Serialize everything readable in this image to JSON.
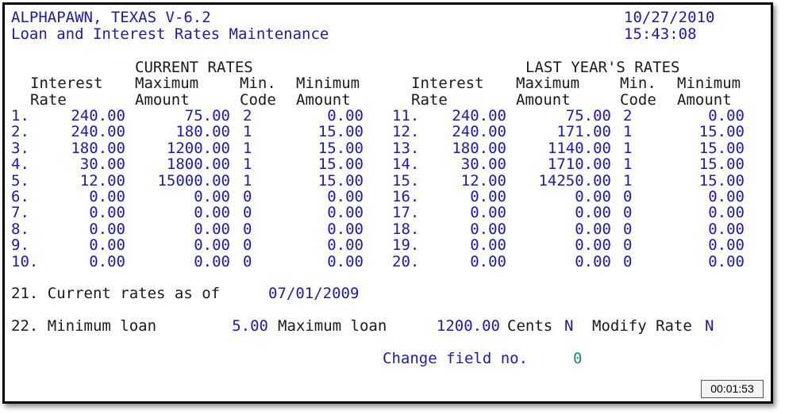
{
  "header": {
    "app_title": "ALPHAPAWN, TEXAS V-6.2",
    "screen_title": "Loan and Interest Rates Maintenance",
    "date": "10/27/2010",
    "time": "15:43:08"
  },
  "current": {
    "section_title": "CURRENT RATES",
    "hdr_interest_1": "Interest",
    "hdr_interest_2": "Rate",
    "hdr_max_1": "Maximum",
    "hdr_max_2": "Amount",
    "hdr_code_1": "Min.",
    "hdr_code_2": "Code",
    "hdr_min_1": "Minimum",
    "hdr_min_2": "Amount",
    "rows": [
      {
        "num": "1.",
        "rate": "240.00",
        "max": "75.00",
        "code": "2",
        "min": "0.00"
      },
      {
        "num": "2.",
        "rate": "240.00",
        "max": "180.00",
        "code": "1",
        "min": "15.00"
      },
      {
        "num": "3.",
        "rate": "180.00",
        "max": "1200.00",
        "code": "1",
        "min": "15.00"
      },
      {
        "num": "4.",
        "rate": "30.00",
        "max": "1800.00",
        "code": "1",
        "min": "15.00"
      },
      {
        "num": "5.",
        "rate": "12.00",
        "max": "15000.00",
        "code": "1",
        "min": "15.00"
      },
      {
        "num": "6.",
        "rate": "0.00",
        "max": "0.00",
        "code": "0",
        "min": "0.00"
      },
      {
        "num": "7.",
        "rate": "0.00",
        "max": "0.00",
        "code": "0",
        "min": "0.00"
      },
      {
        "num": "8.",
        "rate": "0.00",
        "max": "0.00",
        "code": "0",
        "min": "0.00"
      },
      {
        "num": "9.",
        "rate": "0.00",
        "max": "0.00",
        "code": "0",
        "min": "0.00"
      },
      {
        "num": "10.",
        "rate": "0.00",
        "max": "0.00",
        "code": "0",
        "min": "0.00"
      }
    ]
  },
  "last_year": {
    "section_title": "LAST YEAR'S RATES",
    "hdr_interest_1": "Interest",
    "hdr_interest_2": "Rate",
    "hdr_max_1": "Maximum",
    "hdr_max_2": "Amount",
    "hdr_code_1": "Min.",
    "hdr_code_2": "Code",
    "hdr_min_1": "Minimum",
    "hdr_min_2": "Amount",
    "rows": [
      {
        "num": "11.",
        "rate": "240.00",
        "max": "75.00",
        "code": "2",
        "min": "0.00"
      },
      {
        "num": "12.",
        "rate": "240.00",
        "max": "171.00",
        "code": "1",
        "min": "15.00"
      },
      {
        "num": "13.",
        "rate": "180.00",
        "max": "1140.00",
        "code": "1",
        "min": "15.00"
      },
      {
        "num": "14.",
        "rate": "30.00",
        "max": "1710.00",
        "code": "1",
        "min": "15.00"
      },
      {
        "num": "15.",
        "rate": "12.00",
        "max": "14250.00",
        "code": "1",
        "min": "15.00"
      },
      {
        "num": "16.",
        "rate": "0.00",
        "max": "0.00",
        "code": "0",
        "min": "0.00"
      },
      {
        "num": "17.",
        "rate": "0.00",
        "max": "0.00",
        "code": "0",
        "min": "0.00"
      },
      {
        "num": "18.",
        "rate": "0.00",
        "max": "0.00",
        "code": "0",
        "min": "0.00"
      },
      {
        "num": "19.",
        "rate": "0.00",
        "max": "0.00",
        "code": "0",
        "min": "0.00"
      },
      {
        "num": "20.",
        "rate": "0.00",
        "max": "0.00",
        "code": "0",
        "min": "0.00"
      }
    ]
  },
  "field21": {
    "label": "21. Current rates as of",
    "value": "07/01/2009"
  },
  "field22": {
    "label": "22. Minimum loan",
    "min_value": "5.00",
    "max_label": "Maximum loan",
    "max_value": "1200.00",
    "cents_label": "Cents",
    "cents_value": "N",
    "modify_label": "Modify Rate",
    "modify_value": "N"
  },
  "prompt": {
    "label": "Change field no.",
    "value": "0"
  },
  "timer": "00:01:53"
}
